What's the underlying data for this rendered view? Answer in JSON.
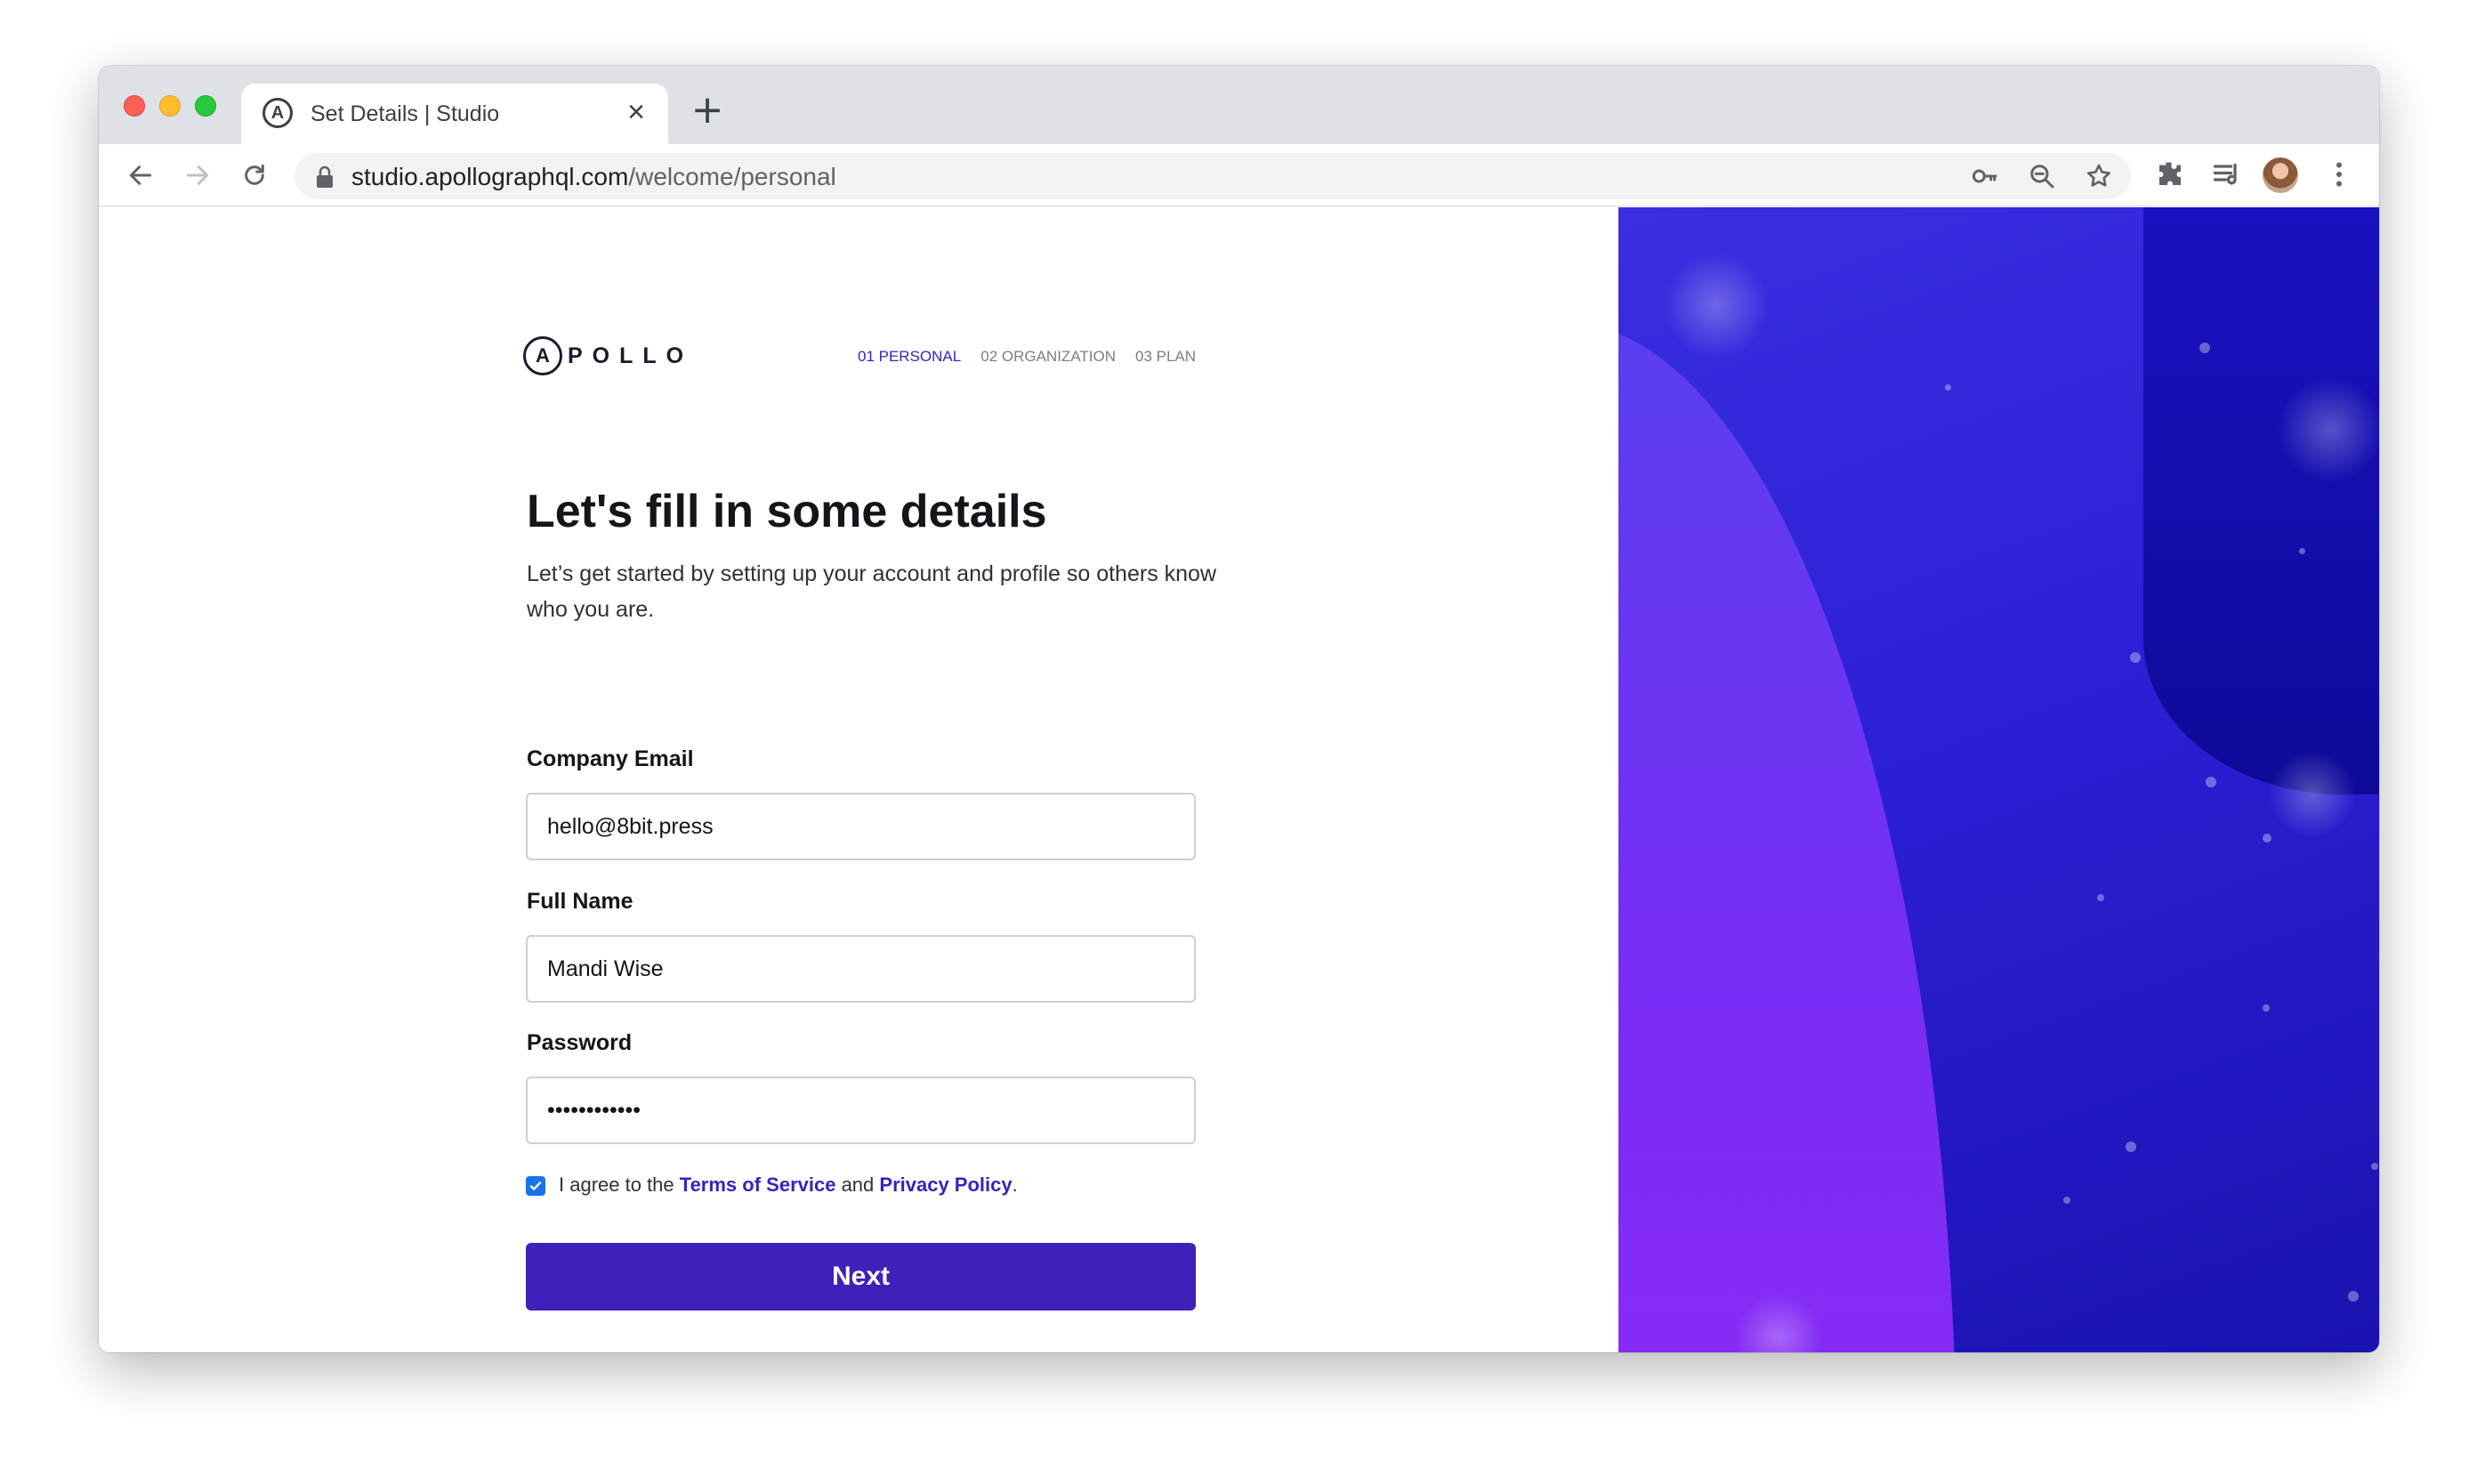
{
  "browser": {
    "tab": {
      "title": "Set Details | Studio",
      "favicon": "apollo-a-icon",
      "close": "×"
    },
    "new_tab": "+",
    "address": {
      "host": "studio.apollographql.com",
      "path": "/welcome/personal"
    }
  },
  "page": {
    "logo": {
      "mark": "A",
      "text": "POLLO"
    },
    "steps": [
      {
        "label": "01 PERSONAL",
        "active": true
      },
      {
        "label": "02 ORGANIZATION",
        "active": false
      },
      {
        "label": "03 PLAN",
        "active": false
      }
    ],
    "heading": "Let's fill in some details",
    "subtext": "Let’s get started by setting up your account and profile so others know who you are.",
    "fields": {
      "email": {
        "label": "Company Email",
        "value": "hello@8bit.press"
      },
      "name": {
        "label": "Full Name",
        "value": "Mandi Wise"
      },
      "password": {
        "label": "Password",
        "value": "••••••••••••"
      }
    },
    "agree": {
      "checked": true,
      "prefix": "I agree to the ",
      "terms": "Terms of Service",
      "and": " and ",
      "privacy": "Privacy Policy",
      "suffix": "."
    },
    "next_button": "Next"
  },
  "colors": {
    "accent": "#3f20ba",
    "gradient_start": "#3a2ee0",
    "gradient_end": "#1a12b0",
    "wave": "#7a2cf5"
  }
}
